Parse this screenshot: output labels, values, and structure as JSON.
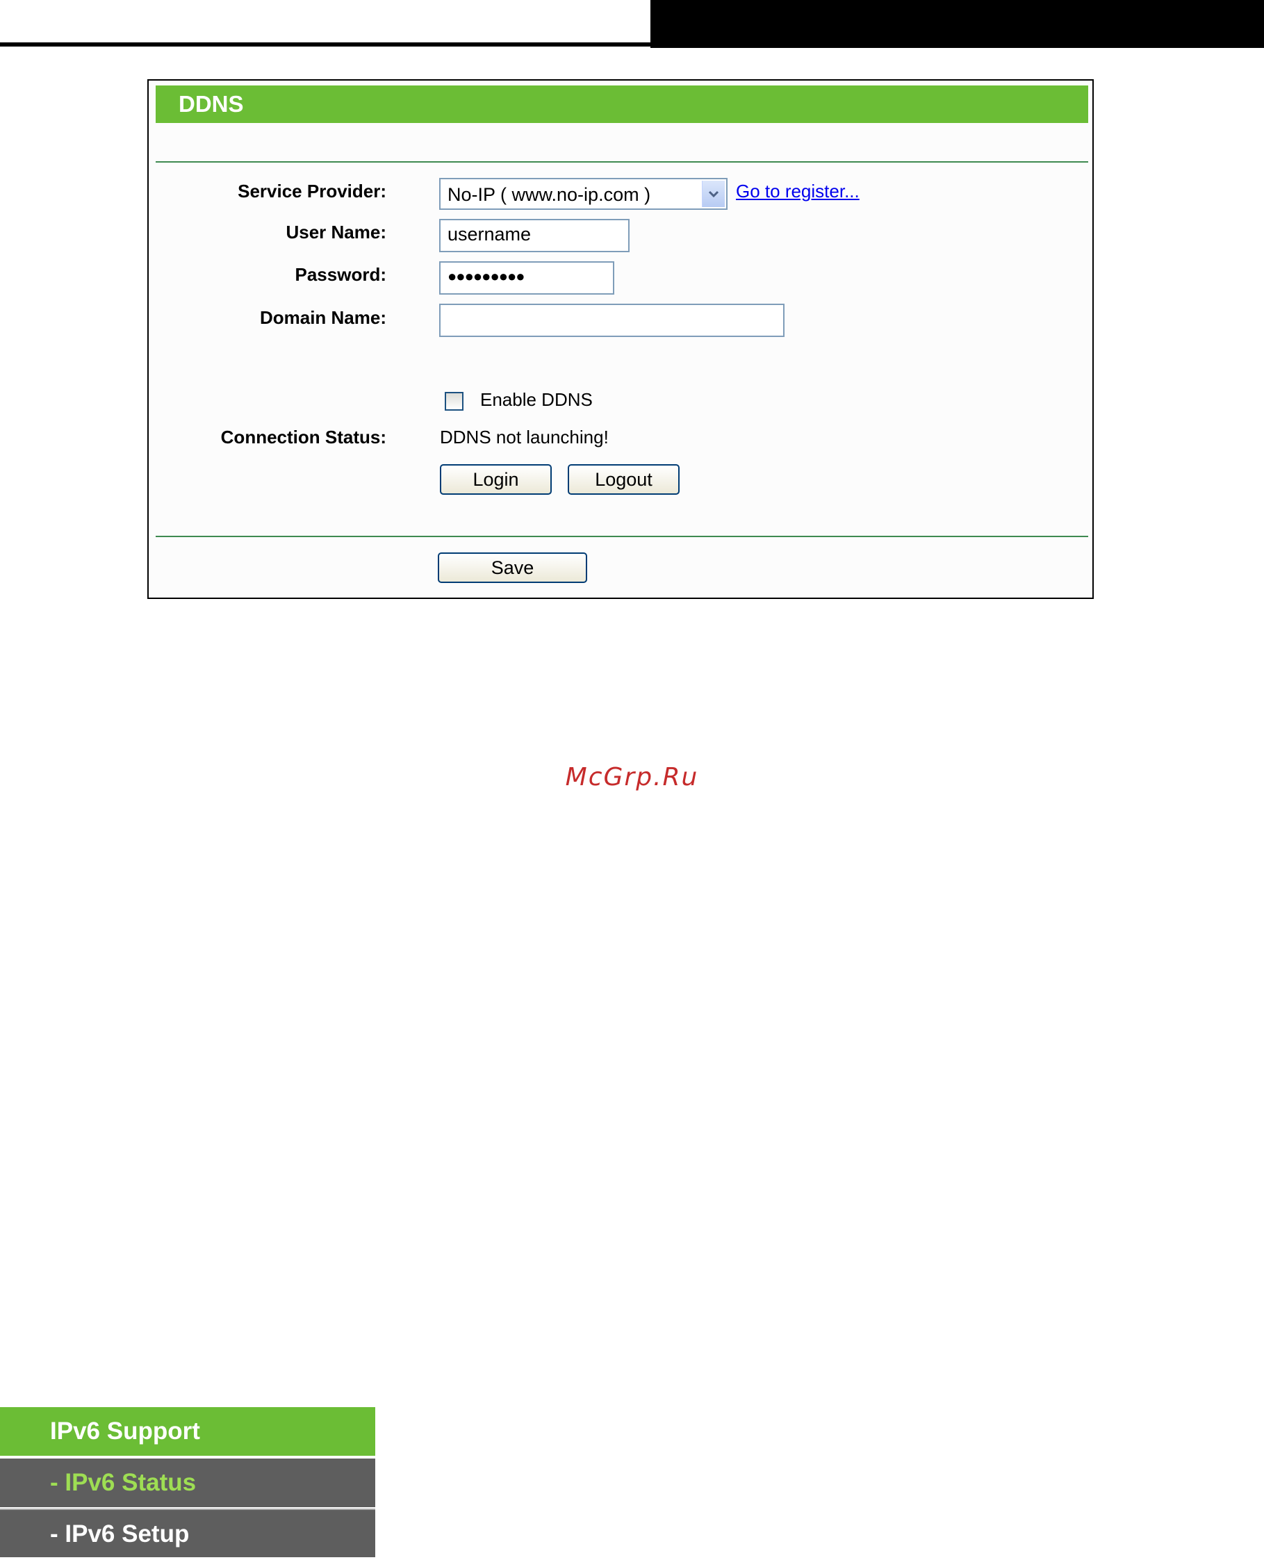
{
  "panel": {
    "title": "DDNS",
    "service_provider_label": "Service Provider:",
    "service_provider_value": "No-IP ( www.no-ip.com )",
    "register_link": "Go to register...",
    "username_label": "User Name:",
    "username_value": "username",
    "password_label": "Password:",
    "password_value": "●●●●●●●●●",
    "domain_label": "Domain Name:",
    "domain_value": "",
    "enable_ddns_label": "Enable DDNS",
    "enable_ddns_checked": false,
    "connection_status_label": "Connection Status:",
    "connection_status_value": "DDNS not launching!",
    "login_button": "Login",
    "logout_button": "Logout",
    "save_button": "Save"
  },
  "watermark": "McGrp.Ru",
  "sidebar_menu": {
    "header": "IPv6 Support",
    "items": [
      {
        "label": "- IPv6 Status",
        "active": true
      },
      {
        "label": "- IPv6 Setup",
        "active": false
      }
    ]
  },
  "colors": {
    "header_green": "#6bbd35",
    "divider_green": "#3e8a50",
    "link_blue": "#0000ee",
    "menu_gray": "#5e5e5e",
    "menu_active_text": "#9ede53",
    "watermark_red": "#c62b2b"
  }
}
